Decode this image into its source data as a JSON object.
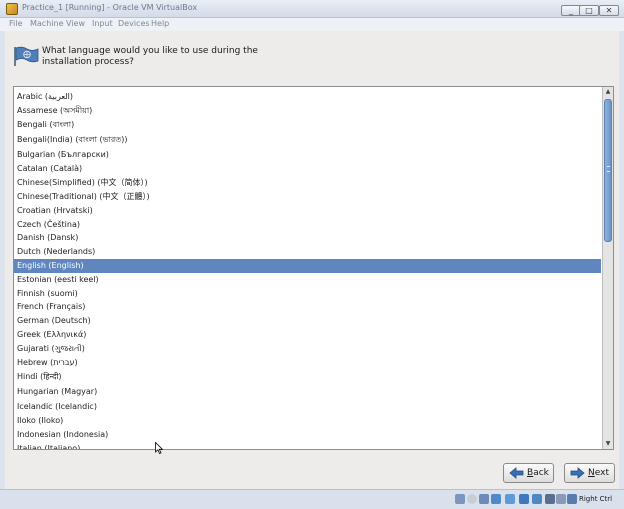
{
  "window": {
    "title": "Practice_1 [Running] - Oracle VM VirtualBox",
    "controls": [
      "_",
      "□",
      "✕"
    ]
  },
  "menu": [
    "File",
    "Machine",
    "View",
    "Input",
    "Devices",
    "Help"
  ],
  "installer": {
    "question_line1": "What language would you like to use during the",
    "question_line2": "installation process?",
    "languages": [
      "Arabic (العربية)",
      "Assamese (অসমীয়া)",
      "Bengali (বাংলা)",
      "Bengali(India) (বাংলা (ভারত))",
      "Bulgarian (Български)",
      "Catalan (Català)",
      "Chinese(Simplified) (中文（简体）)",
      "Chinese(Traditional) (中文（正體）)",
      "Croatian (Hrvatski)",
      "Czech (Čeština)",
      "Danish (Dansk)",
      "Dutch (Nederlands)",
      "English (English)",
      "Estonian (eesti keel)",
      "Finnish (suomi)",
      "French (Français)",
      "German (Deutsch)",
      "Greek (Ελληνικά)",
      "Gujarati (ગુજરાતી)",
      "Hebrew (עברית)",
      "Hindi (हिन्दी)",
      "Hungarian (Magyar)",
      "Icelandic (Icelandic)",
      "Iloko (Iloko)",
      "Indonesian (Indonesia)",
      "Italian (Italiano)"
    ],
    "selected_language": "English (English)",
    "back_label_key": "B",
    "back_label_rest": "ack",
    "next_label_key": "N",
    "next_label_rest": "ext"
  },
  "statusbar": {
    "host_key": "Right Ctrl",
    "tray_icons": [
      "hard-disk-icon",
      "optical-drive-icon",
      "usb-icon",
      "shared-folders-icon",
      "display-icon",
      "network-icon",
      "video-capture-icon",
      "cpu-icon",
      "mouse-integration-icon",
      "keyboard-icon"
    ]
  },
  "colors": {
    "selection": "#5f86be",
    "accent": "#2f63a8"
  }
}
